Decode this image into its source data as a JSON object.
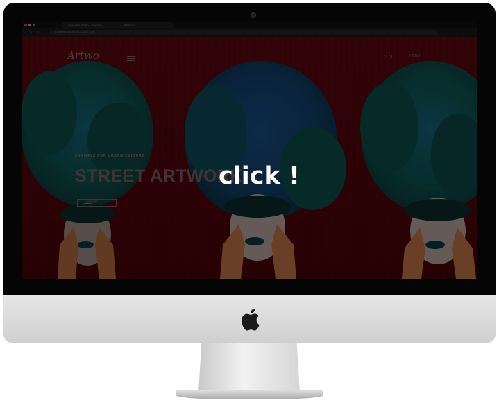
{
  "overlay": {
    "cta_label": "click !"
  },
  "browser": {
    "tabs": [
      "Template demo - Theme",
      "Website"
    ],
    "url": "heartsteam-demos.web.app/"
  },
  "site": {
    "logo": "Artwo",
    "header_link": "MENU",
    "hero": {
      "overline": "EXAMPLE FOR URBAN CULTURE",
      "title": "STREET ARTWORK",
      "button": "SHOW"
    }
  },
  "colors": {
    "page_background": "#4f060c",
    "flowers": "#0f5b55",
    "flowers_center": "#0f4a70",
    "overlay": "#000000"
  },
  "icons": {
    "apple": "apple-logo-icon",
    "menu": "hamburger-icon"
  }
}
